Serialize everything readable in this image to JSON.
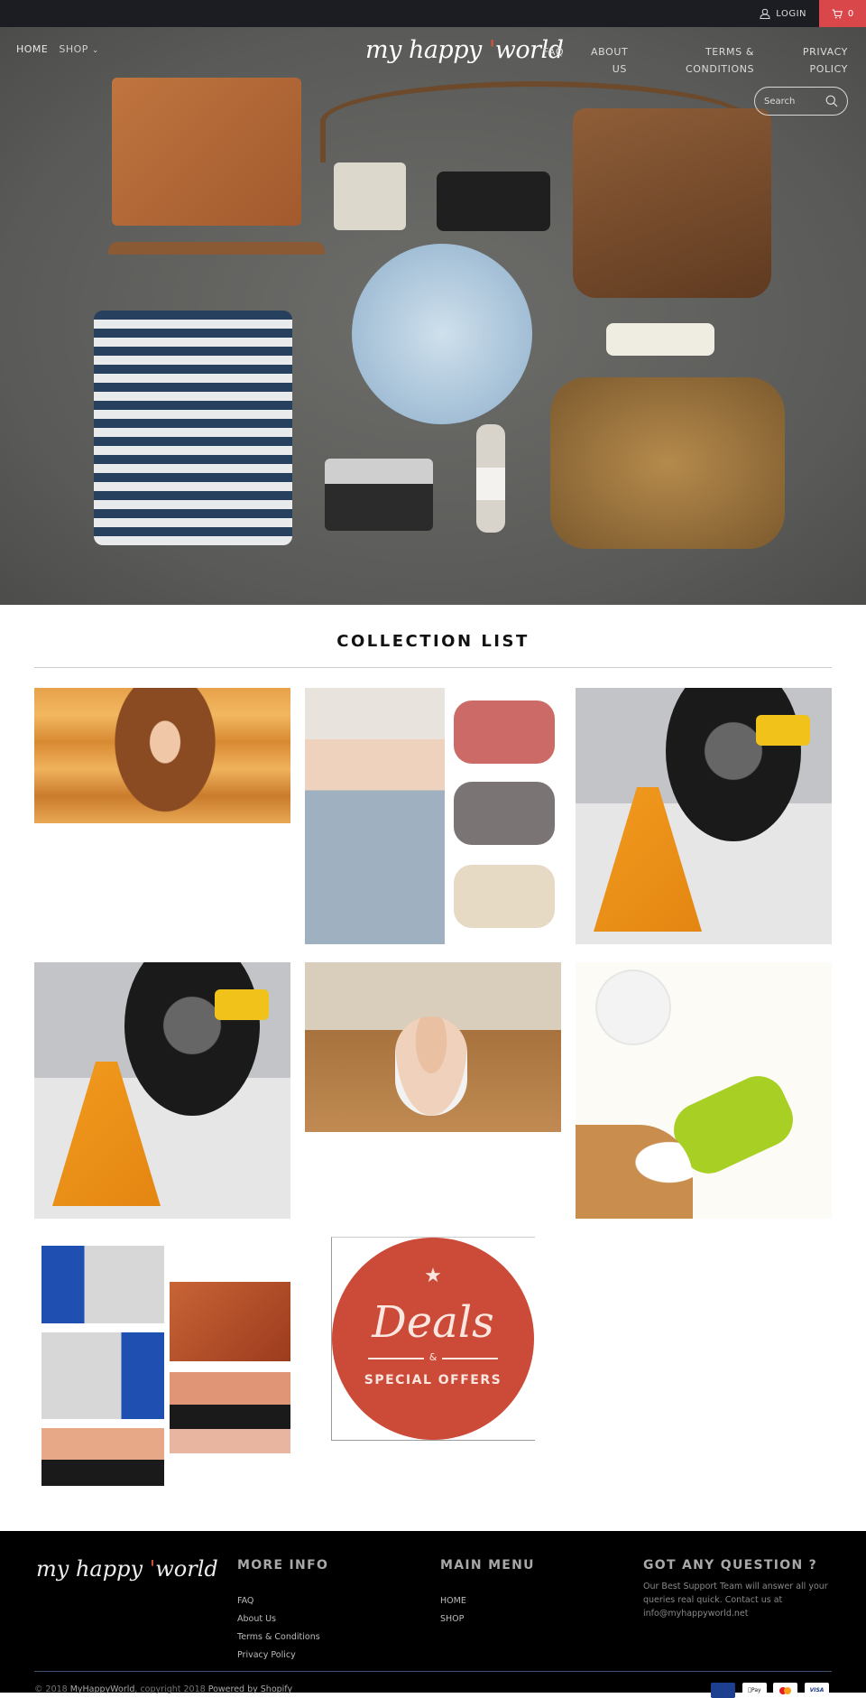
{
  "topbar": {
    "login_label": "LOGIN",
    "cart_count": "0",
    "accent_color": "#d9474b"
  },
  "header": {
    "logo_text_a": "my happy ",
    "logo_text_b": "world",
    "nav_left": [
      {
        "label": "HOME"
      },
      {
        "label": "SHOP"
      }
    ],
    "nav_right": [
      {
        "line1": "FAQ",
        "line2": ""
      },
      {
        "line1": "ABOUT",
        "line2": "US"
      },
      {
        "line1": "TERMS &",
        "line2": "CONDITIONS"
      },
      {
        "line1": "PRIVACY",
        "line2": "POLICY"
      }
    ],
    "search_placeholder": "Search"
  },
  "main": {
    "section_title": "COLLECTION LIST",
    "collections": [
      {
        "image": "woman-with-hair"
      },
      {
        "image": "knit-headbands"
      },
      {
        "image": "electric-car-jack"
      },
      {
        "image": "electric-car-jack"
      },
      {
        "image": "baby-on-floor"
      },
      {
        "image": "pet-water-bottle"
      },
      {
        "image": "car-seat-hooks"
      },
      {
        "image": "deals-badge",
        "badge_script": "Deals",
        "badge_amp": "&",
        "badge_caption": "SPECIAL OFFERS"
      }
    ]
  },
  "footer": {
    "logo_text_a": "my happy ",
    "logo_text_b": "world",
    "more_info": {
      "title": "MORE INFO",
      "links": [
        "FAQ",
        "About Us",
        "Terms & Conditions",
        "Privacy Policy"
      ]
    },
    "main_menu": {
      "title": "MAIN MENU",
      "links": [
        "HOME",
        "SHOP"
      ]
    },
    "question": {
      "title": "GOT ANY QUESTION ?",
      "text": "Our Best Support Team will answer all your queries real quick. Contact us at info@myhappyworld.net"
    },
    "copyright_a": "© 2018 ",
    "copyright_brand": "MyHappyWorld",
    "copyright_b": ", copyright 2018 ",
    "copyright_powered": "Powered by Shopify",
    "payments": [
      "AMEX",
      "Pay",
      "MC",
      "VISA"
    ]
  }
}
